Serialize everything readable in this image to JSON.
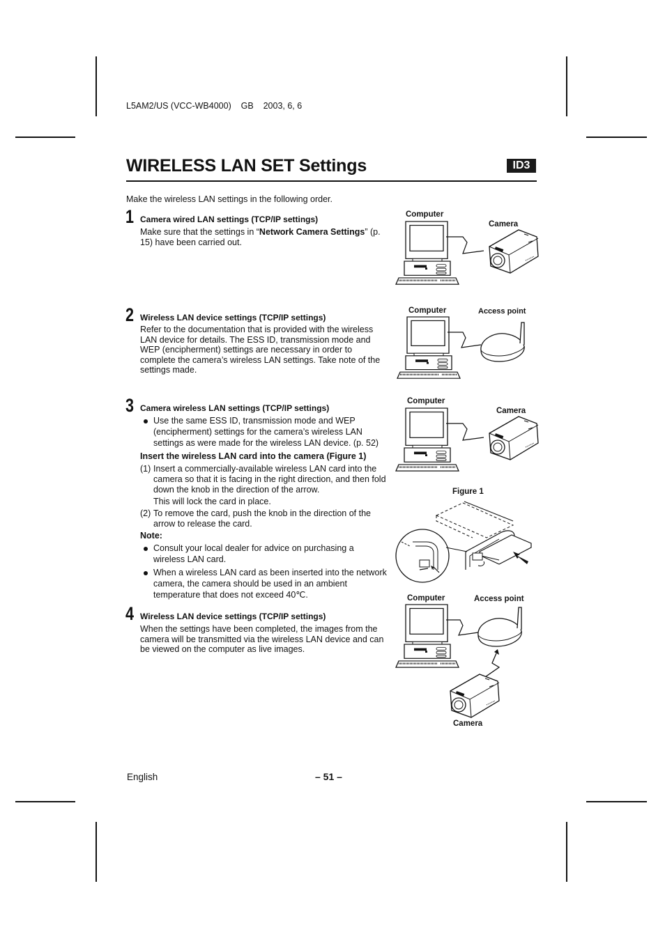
{
  "header": {
    "doc_code": "L5AM2/US (VCC-WB4000)    GB    2003, 6, 6"
  },
  "page": {
    "title": "WIRELESS LAN SET Settings",
    "section_badge": "ID3",
    "intro": "Make the wireless LAN settings in the following order."
  },
  "steps": [
    {
      "number": "1",
      "title": "Camera wired LAN settings (TCP/IP settings)",
      "body_prefix": "Make sure that the settings in “",
      "body_bold": "Network Camera Settings",
      "body_suffix": "” (p. 15) have been carried out."
    },
    {
      "number": "2",
      "title": "Wireless LAN device settings (TCP/IP settings)",
      "body": "Refer to the documentation that is provided with the wireless LAN device for details. The ESS ID, transmission mode and WEP (encipherment) settings are necessary in order to complete the camera’s wireless LAN settings. Take note of the settings made."
    },
    {
      "number": "3",
      "title": "Camera wireless LAN settings (TCP/IP settings)",
      "bullet": "Use the same ESS ID, transmission mode and WEP (encipherment) settings for the camera’s wireless LAN settings as were made for the wireless LAN device. (p. 52)",
      "subheading": "Insert the wireless LAN card into the camera (Figure 1)",
      "items": [
        {
          "n": "(1)",
          "text": "Insert a commercially-available wireless LAN card into the camera so that it is facing in the right direction, and then fold down the knob in the direction of the arrow.",
          "extra": "This will lock the card in place."
        },
        {
          "n": "(2)",
          "text": "To remove the card, push the knob in the direction of the arrow to release the card."
        }
      ],
      "note_label": "Note:",
      "notes": [
        "Consult your local dealer for advice on purchasing a wireless LAN card.",
        "When a wireless LAN card as been inserted into the network camera, the camera should be used in an ambient temperature that does not exceed 40℃."
      ]
    },
    {
      "number": "4",
      "title": "Wireless LAN device settings (TCP/IP settings)",
      "body": "When the settings have been completed, the images from the camera will be transmitted via the wireless LAN device and can be viewed on the computer as live images."
    }
  ],
  "figures": {
    "fig1": {
      "computer": "Computer",
      "camera": "Camera"
    },
    "fig2": {
      "computer": "Computer",
      "access_point": "Access point"
    },
    "fig3": {
      "computer": "Computer",
      "camera": "Camera"
    },
    "figure1_caption": "Figure 1",
    "fig4": {
      "computer": "Computer",
      "access_point": "Access point",
      "camera": "Camera"
    }
  },
  "footer": {
    "language": "English",
    "page_number": "– 51 –"
  }
}
